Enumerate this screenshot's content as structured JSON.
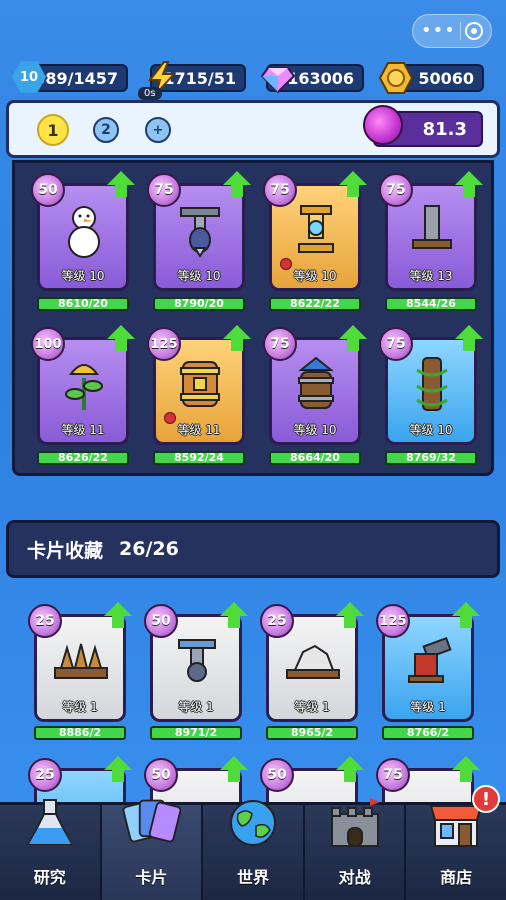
{
  "resources": {
    "trophies": {
      "badge": "10",
      "value": "389/1457"
    },
    "energy": {
      "value": "1715/51",
      "timer": "0s"
    },
    "gems": {
      "value": "163006"
    },
    "coins": {
      "value": "50060"
    }
  },
  "level_tabs": {
    "tab1": "1",
    "tab2": "2",
    "add": "+"
  },
  "elixir": {
    "value": "81.3"
  },
  "deck_cards": [
    {
      "name": "雪人",
      "cost": "50",
      "level": "等级 10",
      "progress": "8610/20",
      "rarity": "purple",
      "icon": "snowman-icon"
    },
    {
      "name": "钻头",
      "cost": "75",
      "level": "等级 10",
      "progress": "8790/20",
      "rarity": "purple",
      "icon": "drill-icon"
    },
    {
      "name": "魔法灯",
      "cost": "75",
      "level": "等级 10",
      "progress": "8622/22",
      "rarity": "gold",
      "icon": "crystal-lamp-icon"
    },
    {
      "name": "锤子",
      "cost": "75",
      "level": "等级 13",
      "progress": "8544/26",
      "rarity": "purple",
      "icon": "hammer-icon"
    },
    {
      "name": "植物",
      "cost": "100",
      "level": "等级 11",
      "progress": "8626/22",
      "rarity": "purple",
      "icon": "plant-icon"
    },
    {
      "name": "宝箱",
      "cost": "125",
      "level": "等级 11",
      "progress": "8592/24",
      "rarity": "gold",
      "icon": "barrel-chest-icon"
    },
    {
      "name": "木桶",
      "cost": "75",
      "level": "等级 10",
      "progress": "8664/20",
      "rarity": "purple",
      "icon": "barrel-icon"
    },
    {
      "name": "荆棘",
      "cost": "75",
      "level": "等级 10",
      "progress": "8769/32",
      "rarity": "blue",
      "icon": "thorn-log-icon"
    }
  ],
  "collection": {
    "title": "卡片收藏",
    "count": "26/26"
  },
  "collection_cards": [
    {
      "cost": "25",
      "level": "等级 1",
      "progress": "8886/2",
      "rarity": "gray",
      "icon": "spikes-icon"
    },
    {
      "cost": "50",
      "level": "等级 1",
      "progress": "8971/2",
      "rarity": "gray",
      "icon": "press-icon"
    },
    {
      "cost": "25",
      "level": "等级 1",
      "progress": "8965/2",
      "rarity": "gray",
      "icon": "rock-icon"
    },
    {
      "cost": "125",
      "level": "等级 1",
      "progress": "8766/2",
      "rarity": "blue",
      "icon": "cannon-icon"
    },
    {
      "cost": "25",
      "rarity": "blue",
      "icon": "card-icon"
    },
    {
      "cost": "50",
      "rarity": "gray",
      "icon": "card-icon"
    },
    {
      "cost": "50",
      "rarity": "gray",
      "icon": "card-icon"
    },
    {
      "cost": "75",
      "rarity": "gray",
      "icon": "card-icon"
    }
  ],
  "nav": {
    "research": "研究",
    "cards": "卡片",
    "world": "世界",
    "battle": "对战",
    "shop": "商店",
    "shop_alert": "!"
  }
}
